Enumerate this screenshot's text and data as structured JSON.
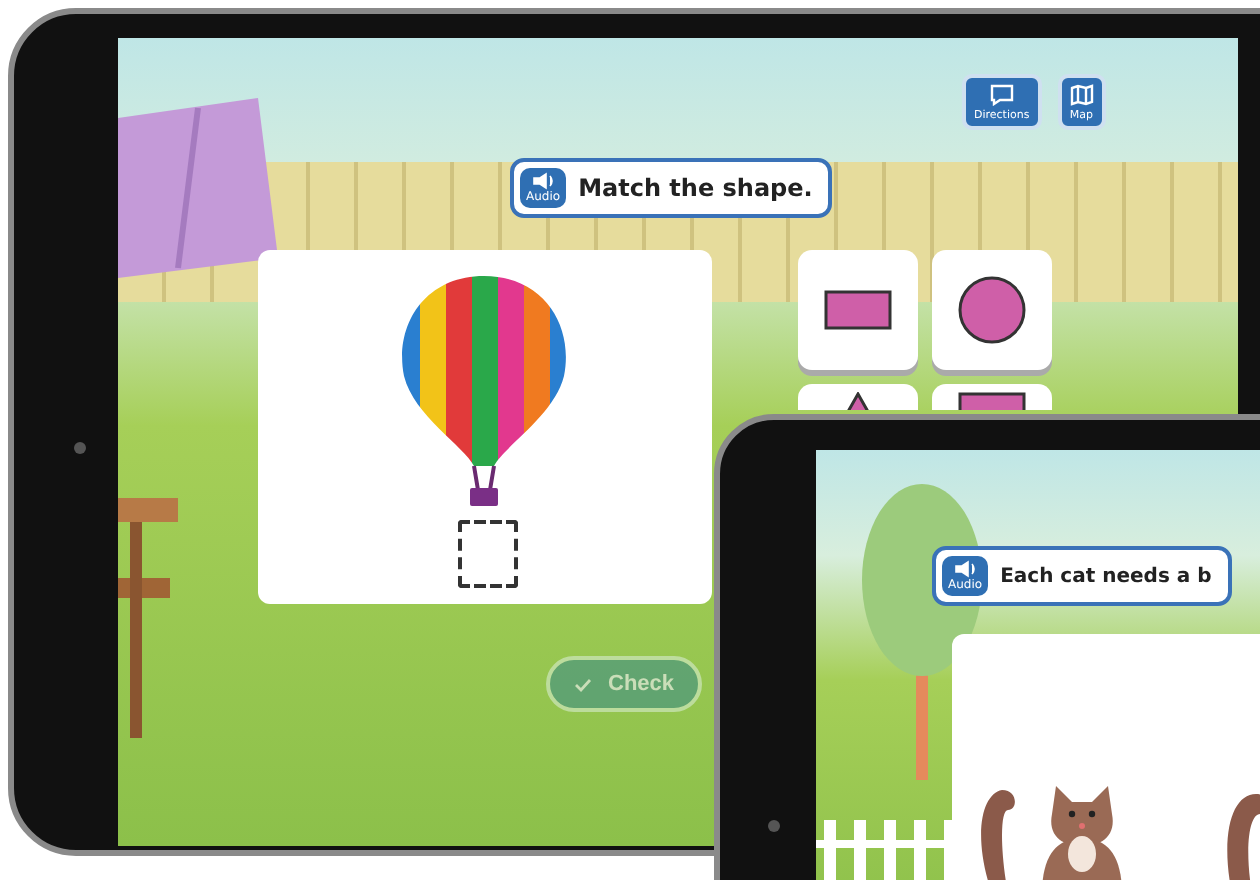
{
  "tablets": [
    {
      "instruction": {
        "audio_label": "Audio",
        "text": "Match the shape."
      },
      "toolbar": [
        {
          "kind": "chat",
          "label": "Directions"
        },
        {
          "kind": "map",
          "label": "Map"
        }
      ],
      "shapes": [
        {
          "kind": "rectangle"
        },
        {
          "kind": "circle"
        },
        {
          "kind": "triangle"
        },
        {
          "kind": "rectangle"
        }
      ],
      "check_button": {
        "label": "Check",
        "disabled": true
      }
    },
    {
      "instruction": {
        "audio_label": "Audio",
        "text": "Each cat needs a b"
      }
    }
  ]
}
